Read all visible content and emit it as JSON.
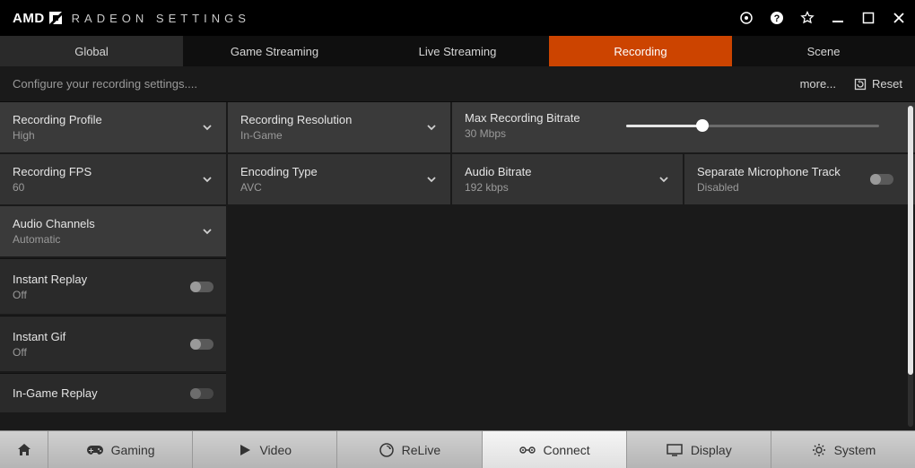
{
  "title": "RADEON SETTINGS",
  "brand": "AMD",
  "tabs": [
    "Global",
    "Game Streaming",
    "Live Streaming",
    "Recording",
    "Scene"
  ],
  "activeTab": 3,
  "subheader": "Configure your recording settings....",
  "moreLabel": "more...",
  "resetLabel": "Reset",
  "settings": {
    "recProfile": {
      "label": "Recording Profile",
      "value": "High"
    },
    "recRes": {
      "label": "Recording Resolution",
      "value": "In-Game"
    },
    "maxBitrate": {
      "label": "Max Recording Bitrate",
      "value": "30 Mbps",
      "percent": 30
    },
    "recFps": {
      "label": "Recording FPS",
      "value": "60"
    },
    "encType": {
      "label": "Encoding Type",
      "value": "AVC"
    },
    "audioBitrate": {
      "label": "Audio Bitrate",
      "value": "192 kbps"
    },
    "sepMic": {
      "label": "Separate Microphone Track",
      "value": "Disabled"
    },
    "audioChannels": {
      "label": "Audio Channels",
      "value": "Automatic"
    },
    "instantReplay": {
      "label": "Instant Replay",
      "value": "Off"
    },
    "instantGif": {
      "label": "Instant Gif",
      "value": "Off"
    },
    "inGameReplay": {
      "label": "In-Game Replay",
      "value": ""
    }
  },
  "bottomNav": {
    "gaming": "Gaming",
    "video": "Video",
    "relive": "ReLive",
    "connect": "Connect",
    "display": "Display",
    "system": "System"
  }
}
